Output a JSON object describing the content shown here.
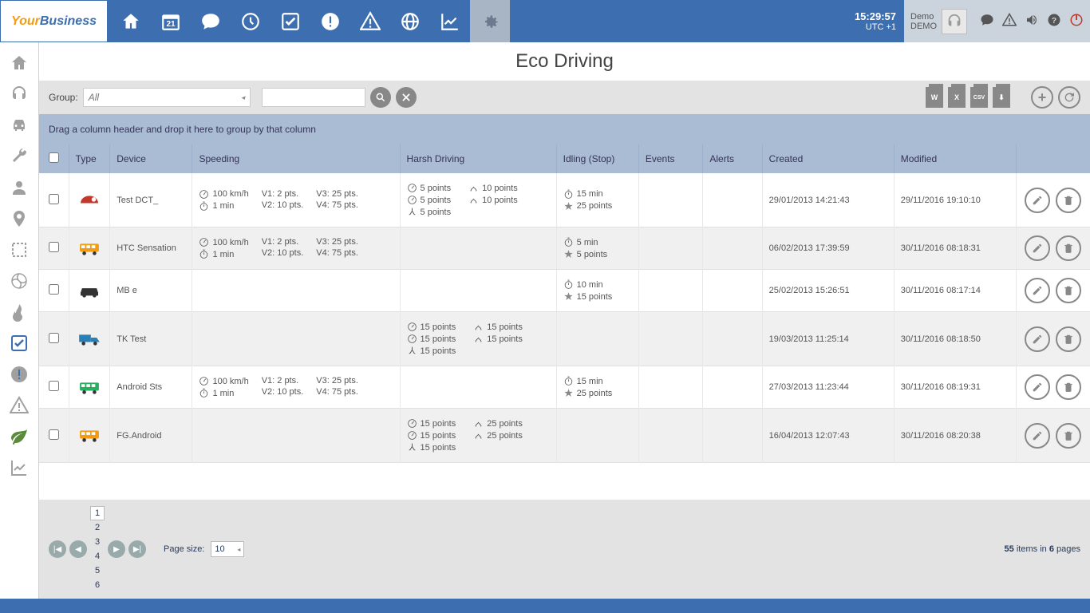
{
  "clock": {
    "time": "15:29:57",
    "tz": "UTC +1"
  },
  "user": {
    "name": "Demo",
    "company": "DEMO"
  },
  "calendar_day": "21",
  "page_title": "Eco Driving",
  "toolbar": {
    "group_label": "Group:",
    "group_value": "All",
    "search_value": ""
  },
  "group_hint": "Drag a column header and drop it here to group by that column",
  "headers": {
    "type": "Type",
    "device": "Device",
    "speeding": "Speeding",
    "harsh": "Harsh Driving",
    "idling": "Idling (Stop)",
    "events": "Events",
    "alerts": "Alerts",
    "created": "Created",
    "modified": "Modified"
  },
  "rows": [
    {
      "type_icon": "helmet-red",
      "device": "Test DCT_",
      "speeding": {
        "speed": "100 km/h",
        "time": "1 min",
        "v1": "V1: 2 pts.",
        "v2": "V2: 10 pts.",
        "v3": "V3: 25 pts.",
        "v4": "V4: 75 pts."
      },
      "harsh": {
        "accel": "5 points",
        "brake": "5 points",
        "corner": "5 points",
        "rpm": "10 points",
        "lane": "10 points"
      },
      "idling": {
        "time": "15 min",
        "points": "25 points"
      },
      "created": "29/01/2013 14:21:43",
      "modified": "29/11/2016 19:10:10"
    },
    {
      "type_icon": "bus-orange",
      "device": "HTC Sensation",
      "speeding": {
        "speed": "100 km/h",
        "time": "1 min",
        "v1": "V1: 2 pts.",
        "v2": "V2: 10 pts.",
        "v3": "V3: 25 pts.",
        "v4": "V4: 75 pts."
      },
      "harsh": null,
      "idling": {
        "time": "5 min",
        "points": "5 points"
      },
      "created": "06/02/2013 17:39:59",
      "modified": "30/11/2016 08:18:31"
    },
    {
      "type_icon": "car-black",
      "device": "MB e",
      "speeding": null,
      "harsh": null,
      "idling": {
        "time": "10 min",
        "points": "15 points"
      },
      "created": "25/02/2013 15:26:51",
      "modified": "30/11/2016 08:17:14"
    },
    {
      "type_icon": "truck-blue",
      "device": "TK Test",
      "speeding": null,
      "harsh": {
        "accel": "15 points",
        "brake": "15 points",
        "corner": "15 points",
        "rpm": "15 points",
        "lane": "15 points"
      },
      "idling": null,
      "created": "19/03/2013 11:25:14",
      "modified": "30/11/2016 08:18:50"
    },
    {
      "type_icon": "van-green",
      "device": "Android Sts",
      "speeding": {
        "speed": "100 km/h",
        "time": "1 min",
        "v1": "V1: 2 pts.",
        "v2": "V2: 10 pts.",
        "v3": "V3: 25 pts.",
        "v4": "V4: 75 pts."
      },
      "harsh": null,
      "idling": {
        "time": "15 min",
        "points": "25 points"
      },
      "created": "27/03/2013 11:23:44",
      "modified": "30/11/2016 08:19:31"
    },
    {
      "type_icon": "bus-orange",
      "device": "FG.Android",
      "speeding": null,
      "harsh": {
        "accel": "15 points",
        "brake": "15 points",
        "corner": "15 points",
        "rpm": "25 points",
        "lane": "25 points"
      },
      "idling": null,
      "created": "16/04/2013 12:07:43",
      "modified": "30/11/2016 08:20:38"
    }
  ],
  "pager": {
    "pages": [
      "1",
      "2",
      "3",
      "4",
      "5",
      "6"
    ],
    "current": "1",
    "page_size_label": "Page size:",
    "page_size": "10",
    "total_items": "55",
    "total_pages": "6",
    "info_items": "items in",
    "info_pages": "pages"
  }
}
